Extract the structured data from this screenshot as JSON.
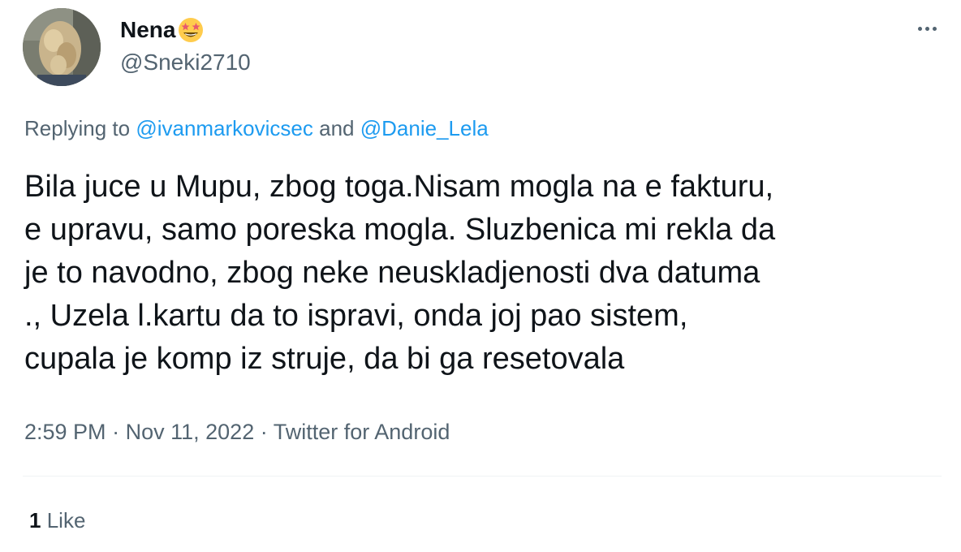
{
  "author": {
    "display_name": "Nena",
    "name_emoji": "star-struck-emoji-icon",
    "handle": "@Sneki2710",
    "avatar": "profile-photo"
  },
  "menu": {
    "icon": "more-dots-icon"
  },
  "reply_context": {
    "prefix": "Replying to",
    "mention_1": "@ivanmarkovicsec",
    "conjunction": "and",
    "mention_2": "@Danie_Lela"
  },
  "tweet": {
    "lines": [
      "Bila juce u Mupu, zbog toga.Nisam mogla na e fakturu,",
      "e upravu, samo poreska mogla. Sluzbenica mi rekla da",
      "je to navodno, zbog neke neuskladjenosti dva datuma",
      "., Uzela l.kartu da to ispravi, onda joj pao sistem,",
      "cupala je komp iz struje, da bi ga resetovala"
    ]
  },
  "meta": {
    "time": "2:59 PM",
    "separator": "·",
    "date": "Nov 11, 2022",
    "source": "Twitter for Android"
  },
  "stats": {
    "like_count": "1",
    "like_label": "Like"
  },
  "colors": {
    "text_primary": "#0f1419",
    "text_secondary": "#536471",
    "link": "#1d9bf0",
    "divider": "#eff3f4"
  }
}
